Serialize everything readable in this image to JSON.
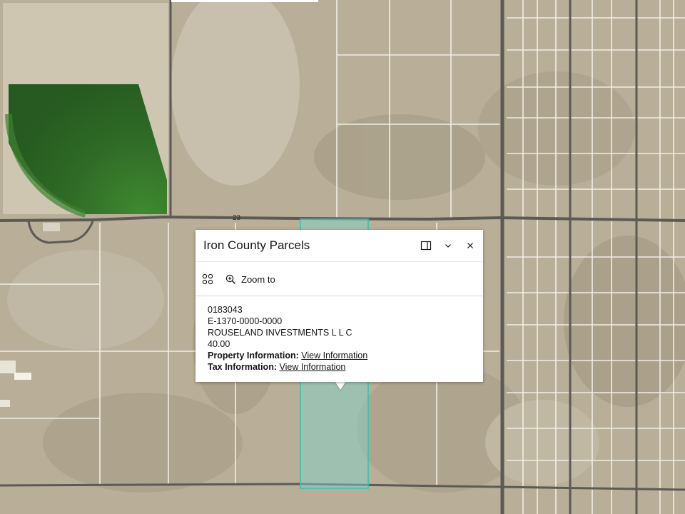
{
  "map": {
    "road_label": "23",
    "colors": {
      "terrain": "#b9ae97",
      "parcel_line": "#f3f1ea",
      "road": "#5c5a55",
      "crop": "#2f6a26",
      "selection_fill": "#7fd8d0",
      "selection_stroke": "#37bfb4"
    }
  },
  "popup": {
    "title": "Iron County Parcels",
    "dock_icon": "dock-icon",
    "collapse_icon": "chevron-down-icon",
    "close_icon": "close-icon",
    "actions": {
      "feature_icon": "circles-grid-icon",
      "zoom_icon": "zoom-in-icon",
      "zoom_label": "Zoom to"
    },
    "fields": {
      "parcel_id": "0183043",
      "account": "E-1370-0000-0000",
      "owner": "ROUSELAND INVESTMENTS L L C",
      "acres": "40.00",
      "property_label": "Property Information:",
      "property_link": "View Information",
      "tax_label": "Tax Information:",
      "tax_link": "View Information"
    }
  }
}
